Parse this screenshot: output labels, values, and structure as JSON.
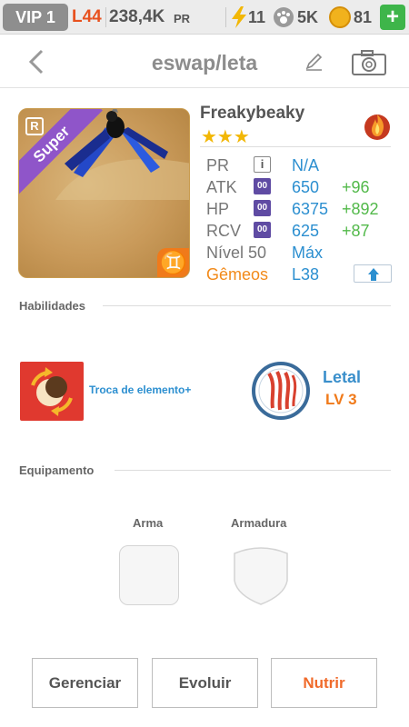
{
  "status": {
    "vip": "VIP 1",
    "level": "L44",
    "pr_value": "238,4K",
    "pr_unit": "PR",
    "energy": "11",
    "paw": "5K",
    "coins": "81",
    "plus": "+"
  },
  "header": {
    "title": "eswap/leta"
  },
  "monster": {
    "rarity_badge": "R",
    "rank": "Super",
    "name": "Freakybeaky",
    "stars": "★★★",
    "element_symbol": "♊",
    "element_color": "#f07a1a"
  },
  "stats": {
    "pr": {
      "label": "PR",
      "icon": "i",
      "value": "N/A"
    },
    "atk": {
      "label": "ATK",
      "icon": "00",
      "value": "650",
      "bonus": "+96"
    },
    "hp": {
      "label": "HP",
      "icon": "00",
      "value": "6375",
      "bonus": "+892"
    },
    "rcv": {
      "label": "RCV",
      "icon": "00",
      "value": "625",
      "bonus": "+87"
    },
    "level": {
      "label": "Nível 50",
      "value": "Máx"
    },
    "twins": {
      "label": "Gêmeos",
      "value": "L38"
    }
  },
  "abilities": {
    "title": "Habilidades",
    "skill": "Troca de elemento+",
    "leader_name": "Letal",
    "leader_level": "LV 3"
  },
  "equipment": {
    "title": "Equipamento",
    "weapon": "Arma",
    "armor": "Armadura"
  },
  "actions": {
    "manage": "Gerenciar",
    "evolve": "Evoluir",
    "feed": "Nutrir"
  }
}
